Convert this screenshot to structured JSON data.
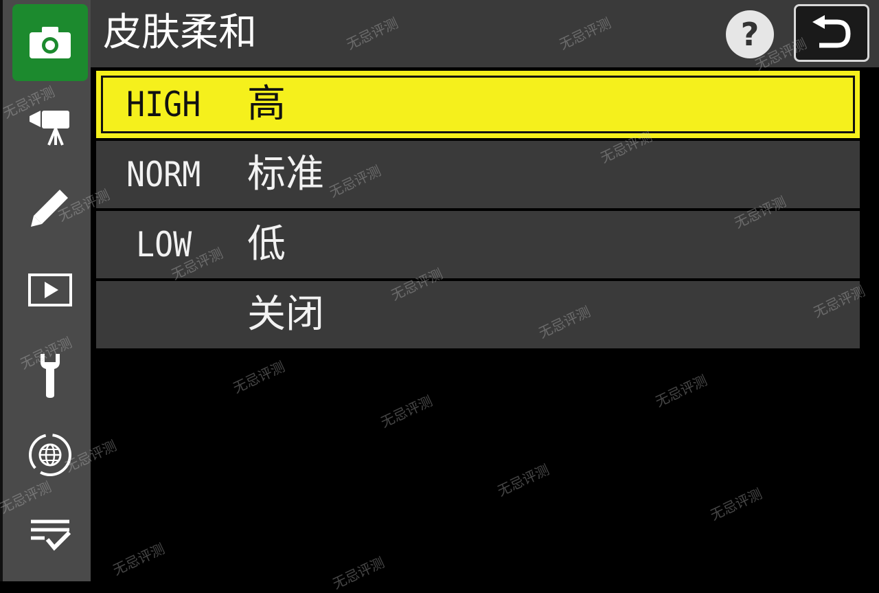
{
  "header": {
    "title": "皮肤柔和",
    "help_label": "?",
    "back_icon": "return-arrow-icon"
  },
  "sidebar": {
    "items": [
      {
        "icon": "camera-icon",
        "active": true
      },
      {
        "icon": "movie-camera-icon",
        "active": false
      },
      {
        "icon": "pencil-icon",
        "active": false
      },
      {
        "icon": "playback-icon",
        "active": false
      },
      {
        "icon": "wrench-icon",
        "active": false
      },
      {
        "icon": "network-globe-icon",
        "active": false
      },
      {
        "icon": "my-menu-icon",
        "active": false
      }
    ]
  },
  "options": [
    {
      "code": "HIGH",
      "label": "高",
      "selected": true
    },
    {
      "code": "NORM",
      "label": "标准",
      "selected": false
    },
    {
      "code": "LOW",
      "label": "低",
      "selected": false
    },
    {
      "code": "",
      "label": "关闭",
      "selected": false
    }
  ],
  "watermark": "无忌评测",
  "colors": {
    "active_tab": "#1c8a2e",
    "selection": "#f5f01c",
    "row_bg": "#3a3a3a"
  }
}
